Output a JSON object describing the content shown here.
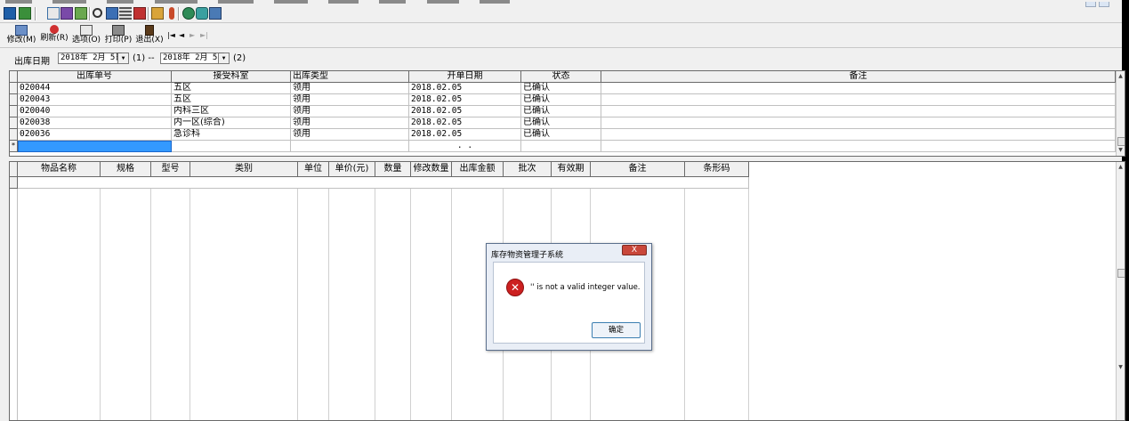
{
  "toolbar": {
    "buttons": [
      {
        "label": "修改(M)",
        "icon": "edit-icon"
      },
      {
        "label": "刷新(R)",
        "icon": "refresh-icon"
      },
      {
        "label": "选项(O)",
        "icon": "options-icon"
      },
      {
        "label": "打印(P)",
        "icon": "print-icon"
      },
      {
        "label": "退出(X)",
        "icon": "exit-icon"
      }
    ],
    "nav": {
      "first": "|◄",
      "prev": "◄",
      "next": "►",
      "last": "►|"
    }
  },
  "filter": {
    "label": "出库日期",
    "date_from": "2018年 2月 5日",
    "sep1": "(1)  --",
    "date_to": "2018年 2月 5日",
    "sep2": "(2)"
  },
  "upper_grid": {
    "columns": [
      "出库单号",
      "接受科室",
      "出库类型",
      "开单日期",
      "状态",
      "备注"
    ],
    "rows": [
      [
        "020044",
        "五区",
        "领用",
        "2018.02.05",
        "已确认",
        ""
      ],
      [
        "020043",
        "五区",
        "领用",
        "2018.02.05",
        "已确认",
        ""
      ],
      [
        "020040",
        "内科三区",
        "领用",
        "2018.02.05",
        "已确认",
        ""
      ],
      [
        "020038",
        "内一区(综合)",
        "领用",
        "2018.02.05",
        "已确认",
        ""
      ],
      [
        "020036",
        "急诊科",
        "领用",
        "2018.02.05",
        "已确认",
        ""
      ]
    ],
    "new_row_marker": "*",
    "new_row_date": ". ."
  },
  "lower_grid": {
    "columns": [
      "物品名称",
      "规格",
      "型号",
      "类别",
      "单位",
      "单价(元)",
      "数量",
      "修改数量",
      "出库金额",
      "批次",
      "有效期",
      "备注",
      "条形码"
    ]
  },
  "dialog": {
    "title": "库存物资管理子系统",
    "close_label": "X",
    "icon": "error-icon",
    "message": "'' is not a valid integer value.",
    "ok_label": "确定"
  }
}
